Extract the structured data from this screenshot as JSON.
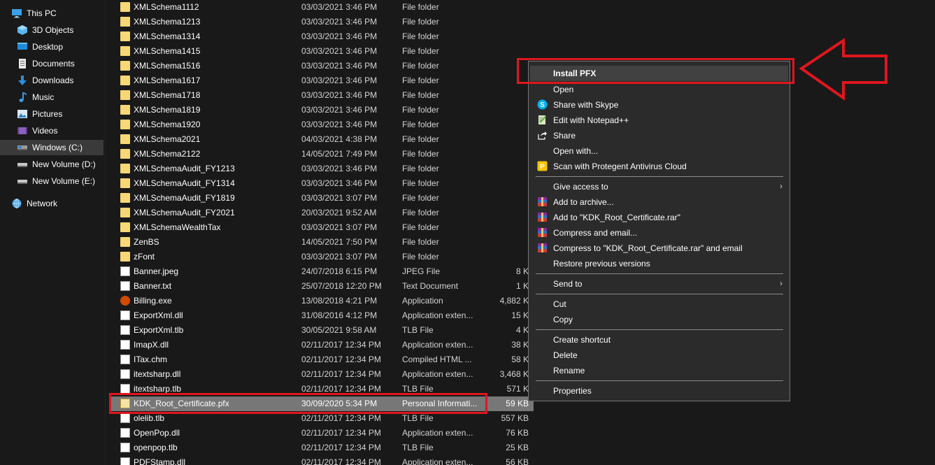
{
  "sidebar": {
    "items": [
      {
        "label": "This PC",
        "icon": "monitor-icon"
      },
      {
        "label": "3D Objects",
        "icon": "cube-icon"
      },
      {
        "label": "Desktop",
        "icon": "desktop-icon"
      },
      {
        "label": "Documents",
        "icon": "documents-icon"
      },
      {
        "label": "Downloads",
        "icon": "download-icon"
      },
      {
        "label": "Music",
        "icon": "music-icon"
      },
      {
        "label": "Pictures",
        "icon": "pictures-icon"
      },
      {
        "label": "Videos",
        "icon": "videos-icon"
      },
      {
        "label": "Windows (C:)",
        "icon": "drive-icon",
        "selected": true
      },
      {
        "label": "New Volume (D:)",
        "icon": "drive-icon"
      },
      {
        "label": "New Volume (E:)",
        "icon": "drive-icon"
      },
      {
        "label": "Network",
        "icon": "network-icon"
      }
    ]
  },
  "files": [
    {
      "name": "XMLSchema1112",
      "date": "03/03/2021 3:46 PM",
      "type": "File folder",
      "size": "",
      "icon": "folder-icon"
    },
    {
      "name": "XMLSchema1213",
      "date": "03/03/2021 3:46 PM",
      "type": "File folder",
      "size": "",
      "icon": "folder-icon"
    },
    {
      "name": "XMLSchema1314",
      "date": "03/03/2021 3:46 PM",
      "type": "File folder",
      "size": "",
      "icon": "folder-icon"
    },
    {
      "name": "XMLSchema1415",
      "date": "03/03/2021 3:46 PM",
      "type": "File folder",
      "size": "",
      "icon": "folder-icon"
    },
    {
      "name": "XMLSchema1516",
      "date": "03/03/2021 3:46 PM",
      "type": "File folder",
      "size": "",
      "icon": "folder-icon"
    },
    {
      "name": "XMLSchema1617",
      "date": "03/03/2021 3:46 PM",
      "type": "File folder",
      "size": "",
      "icon": "folder-icon"
    },
    {
      "name": "XMLSchema1718",
      "date": "03/03/2021 3:46 PM",
      "type": "File folder",
      "size": "",
      "icon": "folder-icon"
    },
    {
      "name": "XMLSchema1819",
      "date": "03/03/2021 3:46 PM",
      "type": "File folder",
      "size": "",
      "icon": "folder-icon"
    },
    {
      "name": "XMLSchema1920",
      "date": "03/03/2021 3:46 PM",
      "type": "File folder",
      "size": "",
      "icon": "folder-icon"
    },
    {
      "name": "XMLSchema2021",
      "date": "04/03/2021 4:38 PM",
      "type": "File folder",
      "size": "",
      "icon": "folder-icon"
    },
    {
      "name": "XMLSchema2122",
      "date": "14/05/2021 7:49 PM",
      "type": "File folder",
      "size": "",
      "icon": "folder-icon"
    },
    {
      "name": "XMLSchemaAudit_FY1213",
      "date": "03/03/2021 3:46 PM",
      "type": "File folder",
      "size": "",
      "icon": "folder-icon"
    },
    {
      "name": "XMLSchemaAudit_FY1314",
      "date": "03/03/2021 3:46 PM",
      "type": "File folder",
      "size": "",
      "icon": "folder-icon"
    },
    {
      "name": "XMLSchemaAudit_FY1819",
      "date": "03/03/2021 3:07 PM",
      "type": "File folder",
      "size": "",
      "icon": "folder-icon"
    },
    {
      "name": "XMLSchemaAudit_FY2021",
      "date": "20/03/2021 9:52 AM",
      "type": "File folder",
      "size": "",
      "icon": "folder-icon"
    },
    {
      "name": "XMLSchemaWealthTax",
      "date": "03/03/2021 3:07 PM",
      "type": "File folder",
      "size": "",
      "icon": "folder-icon"
    },
    {
      "name": "ZenBS",
      "date": "14/05/2021 7:50 PM",
      "type": "File folder",
      "size": "",
      "icon": "folder-icon"
    },
    {
      "name": "zFont",
      "date": "03/03/2021 3:07 PM",
      "type": "File folder",
      "size": "",
      "icon": "folder-icon"
    },
    {
      "name": "Banner.jpeg",
      "date": "24/07/2018 6:15 PM",
      "type": "JPEG File",
      "size": "8 K",
      "icon": "image-file-icon"
    },
    {
      "name": "Banner.txt",
      "date": "25/07/2018 12:20 PM",
      "type": "Text Document",
      "size": "1 K",
      "icon": "text-file-icon"
    },
    {
      "name": "Billing.exe",
      "date": "13/08/2018 4:21 PM",
      "type": "Application",
      "size": "4,882 K",
      "icon": "exe-icon"
    },
    {
      "name": "ExportXml.dll",
      "date": "31/08/2016 4:12 PM",
      "type": "Application exten...",
      "size": "15 K",
      "icon": "dll-file-icon"
    },
    {
      "name": "ExportXml.tlb",
      "date": "30/05/2021 9:58 AM",
      "type": "TLB File",
      "size": "4 K",
      "icon": "file-icon"
    },
    {
      "name": "ImapX.dll",
      "date": "02/11/2017 12:34 PM",
      "type": "Application exten...",
      "size": "38 K",
      "icon": "dll-file-icon"
    },
    {
      "name": "ITax.chm",
      "date": "02/11/2017 12:34 PM",
      "type": "Compiled HTML ...",
      "size": "58 K",
      "icon": "help-file-icon"
    },
    {
      "name": "itextsharp.dll",
      "date": "02/11/2017 12:34 PM",
      "type": "Application exten...",
      "size": "3,468 K",
      "icon": "dll-file-icon"
    },
    {
      "name": "itextsharp.tlb",
      "date": "02/11/2017 12:34 PM",
      "type": "TLB File",
      "size": "571 K",
      "icon": "file-icon"
    },
    {
      "name": "KDK_Root_Certificate.pfx",
      "date": "30/09/2020 5:34 PM",
      "type": "Personal Informati...",
      "size": "59 KB",
      "icon": "certificate-icon",
      "selected": true
    },
    {
      "name": "olelib.tlb",
      "date": "02/11/2017 12:34 PM",
      "type": "TLB File",
      "size": "557 KB",
      "icon": "file-icon"
    },
    {
      "name": "OpenPop.dll",
      "date": "02/11/2017 12:34 PM",
      "type": "Application exten...",
      "size": "76 KB",
      "icon": "dll-file-icon"
    },
    {
      "name": "openpop.tlb",
      "date": "02/11/2017 12:34 PM",
      "type": "TLB File",
      "size": "25 KB",
      "icon": "file-icon"
    },
    {
      "name": "PDFStamp.dll",
      "date": "02/11/2017 12:34 PM",
      "type": "Application exten...",
      "size": "56 KB",
      "icon": "dll-file-icon"
    }
  ],
  "context_menu": {
    "items": [
      {
        "label": "Install PFX",
        "bold": true,
        "hover": true
      },
      {
        "label": "Open"
      },
      {
        "label": "Share with Skype",
        "icon": "skype-icon"
      },
      {
        "label": "Edit with Notepad++",
        "icon": "notepad-plus-plus-icon"
      },
      {
        "label": "Share",
        "icon": "share-icon"
      },
      {
        "label": "Open with..."
      },
      {
        "label": "Scan with Protegent Antivirus Cloud",
        "icon": "protegent-icon"
      },
      {
        "label": "Give access to",
        "submenu": true
      },
      {
        "label": "Add to archive...",
        "icon": "winrar-icon"
      },
      {
        "label": "Add to \"KDK_Root_Certificate.rar\"",
        "icon": "winrar-icon"
      },
      {
        "label": "Compress and email...",
        "icon": "winrar-icon"
      },
      {
        "label": "Compress to \"KDK_Root_Certificate.rar\" and email",
        "icon": "winrar-icon"
      },
      {
        "label": "Restore previous versions"
      },
      {
        "label": "Send to",
        "submenu": true
      },
      {
        "label": "Cut"
      },
      {
        "label": "Copy"
      },
      {
        "label": "Create shortcut"
      },
      {
        "label": "Delete"
      },
      {
        "label": "Rename"
      },
      {
        "label": "Properties"
      }
    ],
    "submenu_arrow": "›"
  },
  "colors": {
    "background": "#191919",
    "menu_background": "#2b2b2b",
    "selection": "#777777",
    "annotation_red": "#e0161e",
    "folder_yellow": "#f8d776"
  }
}
